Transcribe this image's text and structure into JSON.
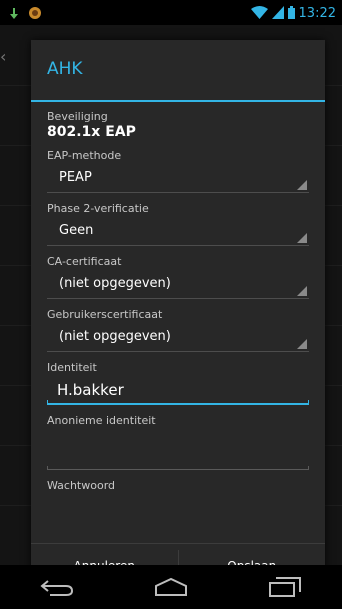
{
  "status_bar": {
    "time": "13:22"
  },
  "dialog": {
    "title": "AHK",
    "security": {
      "label": "Beveiliging",
      "value": "802.1x EAP"
    },
    "eap_method": {
      "label": "EAP-methode",
      "value": "PEAP"
    },
    "phase2": {
      "label": "Phase 2-verificatie",
      "value": "Geen"
    },
    "ca_cert": {
      "label": "CA-certificaat",
      "value": "(niet opgegeven)"
    },
    "user_cert": {
      "label": "Gebruikerscertificaat",
      "value": "(niet opgegeven)"
    },
    "identity": {
      "label": "Identiteit",
      "value": "H.bakker"
    },
    "anon_identity": {
      "label": "Anonieme identiteit",
      "value": ""
    },
    "password": {
      "label": "Wachtwoord"
    },
    "buttons": {
      "cancel": "Annuleren",
      "save": "Opslaan"
    }
  },
  "colors": {
    "accent": "#33b5e5",
    "dialog_bg": "#282828"
  },
  "icons": [
    "download-icon",
    "app-notification-icon",
    "wifi-icon",
    "signal-icon",
    "battery-icon",
    "back-icon",
    "home-icon",
    "recent-apps-icon"
  ]
}
